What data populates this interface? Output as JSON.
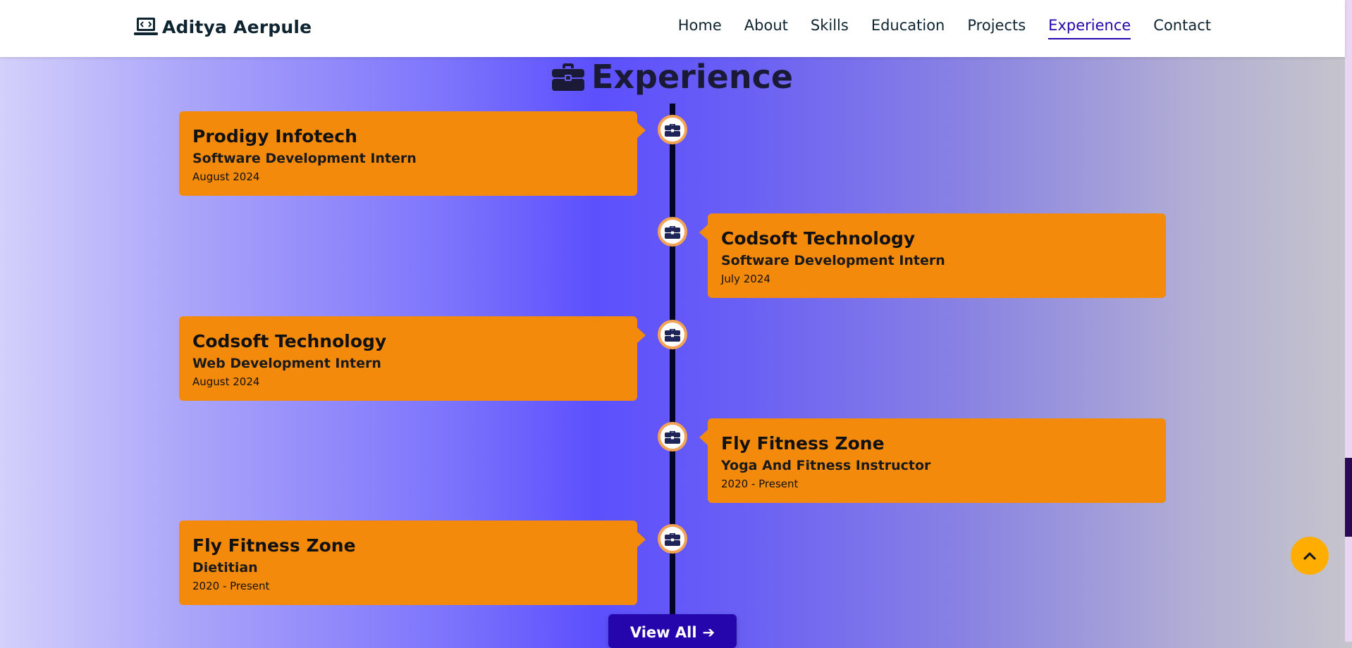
{
  "header": {
    "brand_name": "Aditya Aerpule",
    "nav": [
      {
        "label": "Home"
      },
      {
        "label": "About"
      },
      {
        "label": "Skills"
      },
      {
        "label": "Education"
      },
      {
        "label": "Projects"
      },
      {
        "label": "Experience",
        "active": true
      },
      {
        "label": "Contact"
      }
    ]
  },
  "section": {
    "title": "Experience",
    "icon": "briefcase-icon"
  },
  "experience": [
    {
      "company": "Prodigy Infotech",
      "role": "Software Development Intern",
      "date": "August 2024",
      "side": "left"
    },
    {
      "company": "Codsoft Technology",
      "role": "Software Development Intern",
      "date": "July 2024",
      "side": "right"
    },
    {
      "company": "Codsoft Technology",
      "role": "Web Development Intern",
      "date": "August 2024",
      "side": "left"
    },
    {
      "company": "Fly Fitness Zone",
      "role": "Yoga And Fitness Instructor",
      "date": "2020 - Present",
      "side": "right"
    },
    {
      "company": "Fly Fitness Zone",
      "role": "Dietitian",
      "date": "2020 - Present",
      "side": "left"
    }
  ],
  "view_all": {
    "label": "View All"
  },
  "colors": {
    "card": "#f48a0c",
    "accent": "#2506ad",
    "node_border": "#f4a255",
    "scroll_top_button": "#ffae00"
  }
}
